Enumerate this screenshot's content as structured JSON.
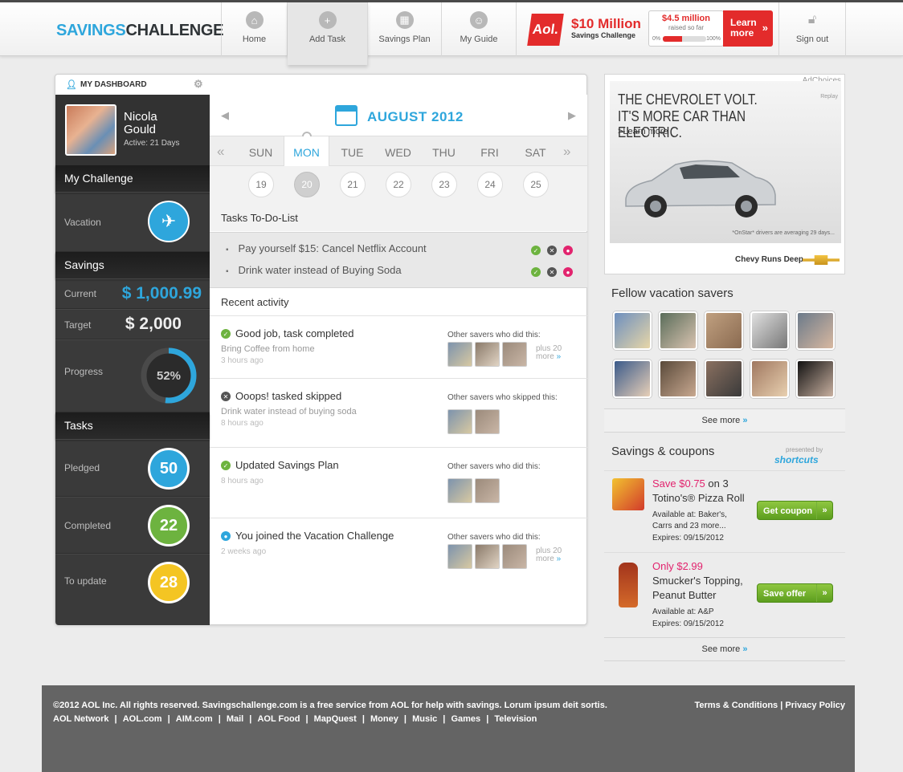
{
  "header": {
    "logo_part1": "SAVINGS",
    "logo_part2": "CHALLENGE",
    "nav": [
      {
        "label": "Home",
        "icon": "home-icon"
      },
      {
        "label": "Add Task",
        "icon": "plus-icon"
      },
      {
        "label": "Savings Plan",
        "icon": "calculator-icon"
      },
      {
        "label": "My Guide",
        "icon": "guide-icon"
      }
    ],
    "promo": {
      "logo": "Aol.",
      "title": "$10 Million",
      "subtitle": "Savings Challenge",
      "raised_amount": "$4.5 million",
      "raised_label": "raised so far",
      "meter_min": "0%",
      "meter_max": "100%",
      "meter_fraction": 0.45,
      "button_line1": "Learn",
      "button_line2": "more",
      "button_arrow": "»"
    },
    "signout_label": "Sign out"
  },
  "dashboard": {
    "tab_label": "MY DASHBOARD",
    "profile": {
      "first_name": "Nicola",
      "last_name": "Gould",
      "active": "Active: 21 Days"
    },
    "my_challenge_heading": "My Challenge",
    "challenge_label": "Vacation",
    "savings_heading": "Savings",
    "current_label": "Current",
    "current_value": "$ 1,000.99",
    "target_label": "Target",
    "target_value": "$ 2,000",
    "progress_label": "Progress",
    "progress_value": "52%",
    "progress_fraction": 0.52,
    "tasks_heading": "Tasks",
    "pledged_label": "Pledged",
    "pledged_value": "50",
    "completed_label": "Completed",
    "completed_value": "22",
    "to_update_label": "To update",
    "to_update_value": "28"
  },
  "calendar": {
    "month": "AUGUST 2012",
    "days": [
      "SUN",
      "MON",
      "TUE",
      "WED",
      "THU",
      "FRI",
      "SAT"
    ],
    "dates": [
      "19",
      "20",
      "21",
      "22",
      "23",
      "24",
      "25"
    ],
    "active_index": 1
  },
  "todo": {
    "heading": "Tasks To-Do-List",
    "items": [
      "Pay yourself $15: Cancel Netflix Account",
      "Drink water instead of Buying Soda"
    ]
  },
  "recent": {
    "heading": "Recent activity",
    "items": [
      {
        "title": "Good job, task completed",
        "sub": "Bring Coffee from home",
        "time": "3 hours ago",
        "other": "Other savers who did this:",
        "plus": "plus 20",
        "more": "more",
        "status": "done"
      },
      {
        "title": "Ooops! tasked skipped",
        "sub": "Drink water instead of buying soda",
        "time": "8 hours ago",
        "other": "Other savers who skipped this:",
        "plus": "",
        "more": "",
        "status": "skipped"
      },
      {
        "title": "Updated Savings Plan",
        "sub": "",
        "time": "8 hours ago",
        "other": "Other savers who did this:",
        "plus": "",
        "more": "",
        "status": "done"
      },
      {
        "title": "You joined the Vacation Challenge",
        "sub": "",
        "time": "2 weeks ago",
        "other": "Other savers who did this:",
        "plus": "plus 20",
        "more": "more",
        "status": "joined"
      }
    ]
  },
  "ad": {
    "adchoices": "AdChoices",
    "replay": "Replay",
    "headline1": "THE CHEVROLET VOLT.",
    "headline2": "IT'S MORE CAR THAN ELECTRIC.",
    "learn": ">Learn more",
    "fine": "*OnStar* drivers are averaging 29 days...",
    "brand": "Chevy Runs Deep"
  },
  "fellow": {
    "heading": "Fellow vacation savers",
    "see_more": "See more"
  },
  "coupons": {
    "heading": "Savings & coupons",
    "presented": "presented by",
    "sponsor": "shortcuts",
    "items": [
      {
        "save": "Save $0.75",
        "save_suffix": "on 3",
        "name1": "Totino's® Pizza Roll",
        "avail1": "Available at: Baker's,",
        "avail2": "Carrs and 23 more...",
        "expires": "Expires: 09/15/2012",
        "button": "Get coupon"
      },
      {
        "save": "Only $2.99",
        "save_suffix": "",
        "name1": "Smucker's Topping,",
        "name2": "Peanut Butter",
        "avail1": "Available at: A&P",
        "expires": "Expires: 09/15/2012",
        "button": "Save offer"
      }
    ],
    "see_more": "See more"
  },
  "footer": {
    "copyright": "©2012 AOL Inc. All rights reserved. Savingschallenge.com is a free service from AOL for help with savings. Lorum ipsum deit sortis.",
    "links": [
      "AOL Network",
      "AOL.com",
      "AIM.com",
      "Mail",
      "AOL Food",
      "MapQuest",
      "Money",
      "Music",
      "Games",
      "Television"
    ],
    "terms": "Terms & Conditions",
    "privacy": "Privacy Policy"
  },
  "colors": {
    "accent": "#2ea6dc",
    "brand_red": "#e32b2b",
    "green": "#6db33f",
    "yellow": "#f4c523",
    "coupon_pink": "#e2246e"
  }
}
